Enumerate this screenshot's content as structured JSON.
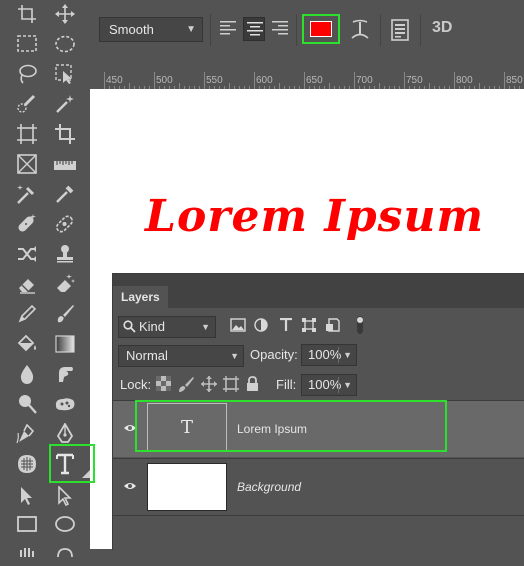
{
  "options_bar": {
    "antialias_value": "Smooth",
    "text_color": "#ff0000",
    "label_3d": "3D",
    "icons": [
      "align-left-icon",
      "align-center-icon",
      "align-right-icon",
      "warp-text-icon",
      "character-panel-icon"
    ]
  },
  "ruler": {
    "labels": [
      "450",
      "500",
      "550",
      "600",
      "650",
      "700",
      "750",
      "800",
      "850"
    ]
  },
  "canvas": {
    "text": "Lorem Ipsum",
    "text_color": "#ff0000"
  },
  "toolbar": {
    "highlight_color": "#2ee02e",
    "active_tool": "type-tool"
  },
  "layers_panel": {
    "tab_label": "Layers",
    "filter_kind": "Kind",
    "blend_mode": "Normal",
    "opacity_label": "Opacity:",
    "opacity_value": "100%",
    "lock_label": "Lock:",
    "fill_label": "Fill:",
    "fill_value": "100%",
    "layers": [
      {
        "name": "Lorem Ipsum",
        "thumb_glyph": "T",
        "type": "text",
        "selected": true
      },
      {
        "name": "Background",
        "type": "background",
        "selected": false
      }
    ]
  }
}
